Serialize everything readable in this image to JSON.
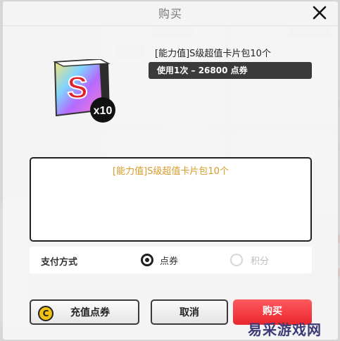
{
  "dialog": {
    "title": "购买",
    "item_name": "[能力值]S级超值卡片包10个",
    "price_text": "使用1次 – 26800 点券",
    "description": "[能力值]S级超值卡片包10个",
    "icon_badge": "x10",
    "icon_letter": "S"
  },
  "payment": {
    "label": "支付方式",
    "options": [
      {
        "label": "点券",
        "selected": true
      },
      {
        "label": "积分",
        "selected": false
      }
    ]
  },
  "buttons": {
    "recharge": "充值点券",
    "recharge_icon_letter": "C",
    "cancel": "取消",
    "buy": "购买"
  },
  "colors": {
    "description_text": "#d79b2a",
    "buy_button": "#e8262c",
    "price_bar": "#3a3a3a",
    "coin": "#f0c012"
  },
  "watermark": "易采游戏网"
}
